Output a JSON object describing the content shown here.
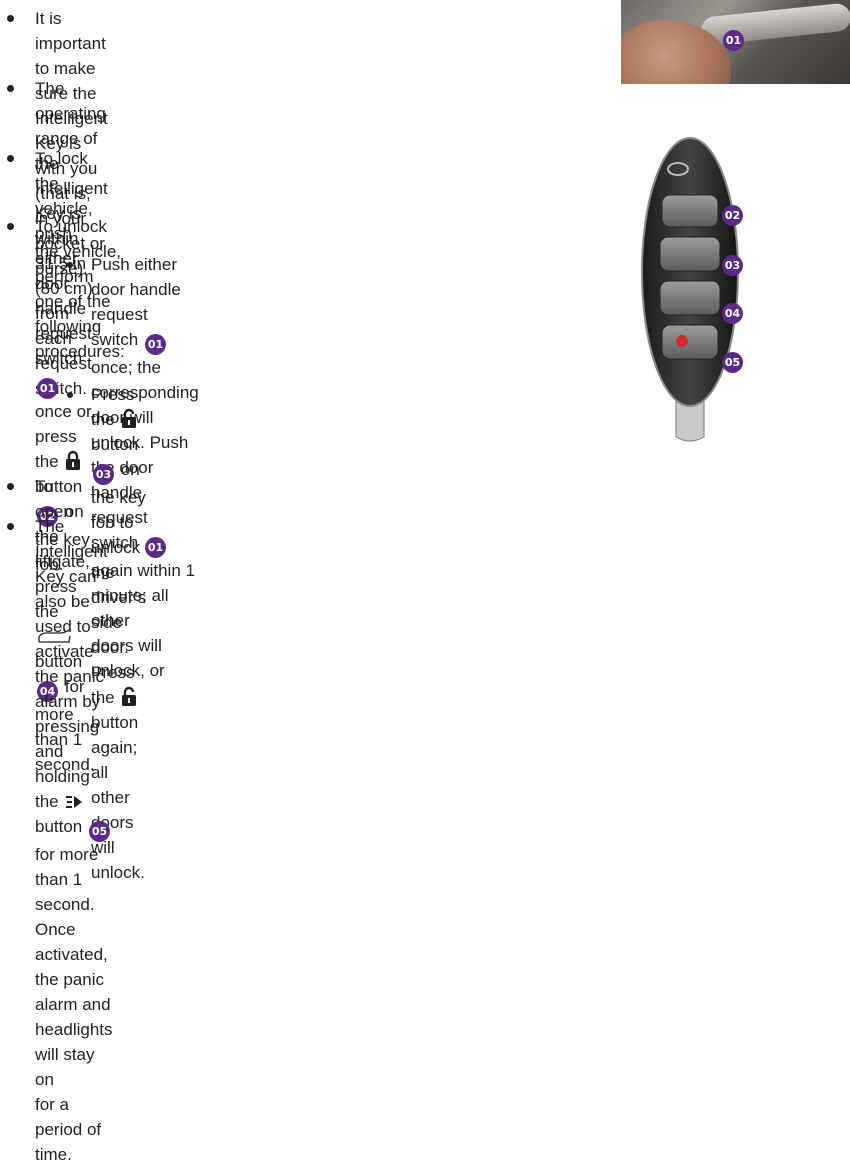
{
  "badges": {
    "b01": "01",
    "b02": "02",
    "b03": "03",
    "b04": "04",
    "b05": "05"
  },
  "items": [
    {
      "lines": [
        "It is important to make sure the Intelligent Key is",
        "with you (that is, in your pocket or purse)."
      ]
    },
    {
      "lines": [
        "The operating range of the Intelligent Key is within",
        "31.5 in (80 cm) from each request switch."
      ]
    },
    {
      "line1_a": "To lock the vehicle, push either door handle request",
      "line2_a": "switch",
      "line2_b": "once or press the",
      "line2_c": "button",
      "line2_d": "on the key fob."
    },
    {
      "text": "To unlock the vehicle, perform one of the following procedures:"
    },
    {
      "line1": "Push either door handle request switch",
      "line1_b": "once; the",
      "line2": "corresponding door will unlock. Push the door handle",
      "line3_a": "request switch",
      "line3_b": "again within 1 minute; all other",
      "line4": "doors will unlock, or"
    },
    {
      "line1_a": "Press the",
      "line1_b": "button",
      "line1_c": "on the key fob to unlock the driver’s",
      "line2_a": "side door. Press the",
      "line2_b": "button again; all other doors will",
      "line3": "unlock."
    },
    {
      "a": "To open the liftgate, press the",
      "b": "button",
      "c": "for more than 1 second."
    },
    {
      "line1": "The Intelligent Key can also be used to activate the panic alarm by pressing and holding the",
      "line2_b": "for more than 1 second. Once activated, the panic alarm and headlights will stay on",
      "line2_a": "button",
      "line3": "for a period of time."
    }
  ],
  "colors": {
    "badge": "#5b2a86",
    "text": "#231f20"
  },
  "icons": [
    "lock-icon",
    "unlock-icon",
    "liftgate-icon",
    "panic-icon"
  ]
}
